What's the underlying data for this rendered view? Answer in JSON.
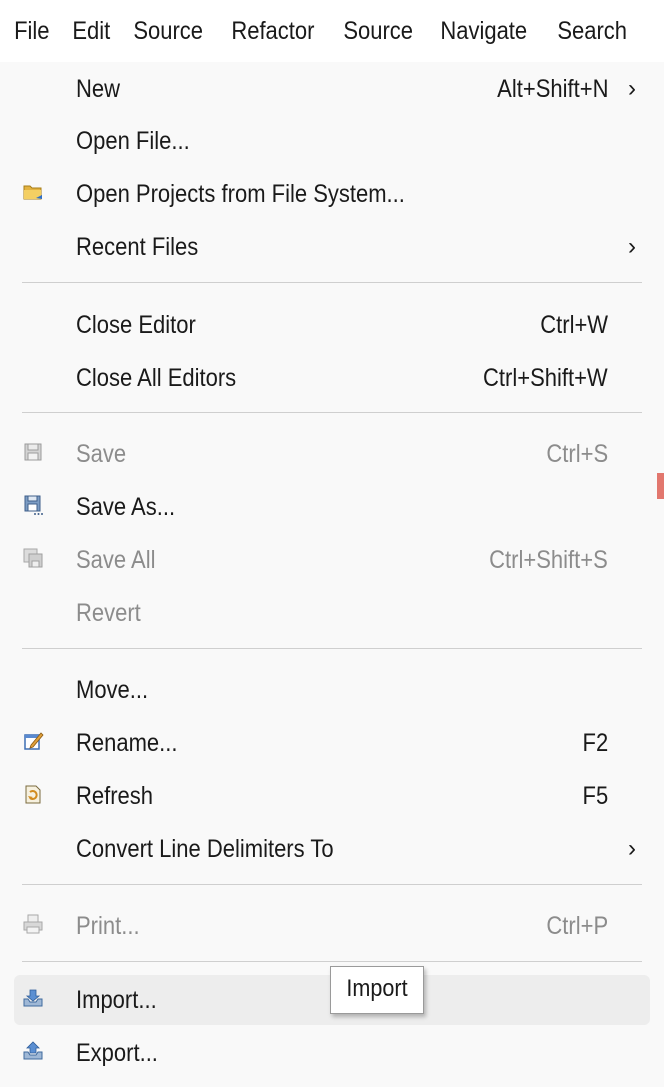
{
  "menubar": {
    "items": [
      "File",
      "Edit",
      "Source",
      "Refactor",
      "Source",
      "Navigate",
      "Search"
    ]
  },
  "file_menu": {
    "items": [
      {
        "label": "New",
        "shortcut": "Alt+Shift+N",
        "submenu": true,
        "enabled": true,
        "icon": ""
      },
      {
        "label": "Open File...",
        "shortcut": "",
        "submenu": false,
        "enabled": true,
        "icon": ""
      },
      {
        "label": "Open Projects from File System...",
        "shortcut": "",
        "submenu": false,
        "enabled": true,
        "icon": "folder-icon"
      },
      {
        "label": "Recent Files",
        "shortcut": "",
        "submenu": true,
        "enabled": true,
        "icon": ""
      },
      {
        "label": "Close Editor",
        "shortcut": "Ctrl+W",
        "submenu": false,
        "enabled": true,
        "icon": ""
      },
      {
        "label": "Close All Editors",
        "shortcut": "Ctrl+Shift+W",
        "submenu": false,
        "enabled": true,
        "icon": ""
      },
      {
        "label": "Save",
        "shortcut": "Ctrl+S",
        "submenu": false,
        "enabled": false,
        "icon": "save-icon"
      },
      {
        "label": "Save As...",
        "shortcut": "",
        "submenu": false,
        "enabled": true,
        "icon": "save-as-icon"
      },
      {
        "label": "Save All",
        "shortcut": "Ctrl+Shift+S",
        "submenu": false,
        "enabled": false,
        "icon": "save-all-icon"
      },
      {
        "label": "Revert",
        "shortcut": "",
        "submenu": false,
        "enabled": false,
        "icon": ""
      },
      {
        "label": "Move...",
        "shortcut": "",
        "submenu": false,
        "enabled": true,
        "icon": ""
      },
      {
        "label": "Rename...",
        "shortcut": "F2",
        "submenu": false,
        "enabled": true,
        "icon": "rename-icon"
      },
      {
        "label": "Refresh",
        "shortcut": "F5",
        "submenu": false,
        "enabled": true,
        "icon": "refresh-icon"
      },
      {
        "label": "Convert Line Delimiters To",
        "shortcut": "",
        "submenu": true,
        "enabled": true,
        "icon": ""
      },
      {
        "label": "Print...",
        "shortcut": "Ctrl+P",
        "submenu": false,
        "enabled": false,
        "icon": "print-icon"
      },
      {
        "label": "Import...",
        "shortcut": "",
        "submenu": false,
        "enabled": true,
        "icon": "import-icon",
        "hovered": true
      },
      {
        "label": "Export...",
        "shortcut": "",
        "submenu": false,
        "enabled": true,
        "icon": "export-icon"
      }
    ],
    "submenu_arrow": "›"
  },
  "tooltip": {
    "text": "Import"
  },
  "colors": {
    "menu_bg": "#f9f9f9",
    "hover_bg": "#ededed",
    "disabled_text": "#8c8c8c",
    "separator": "#cfcfcf"
  }
}
